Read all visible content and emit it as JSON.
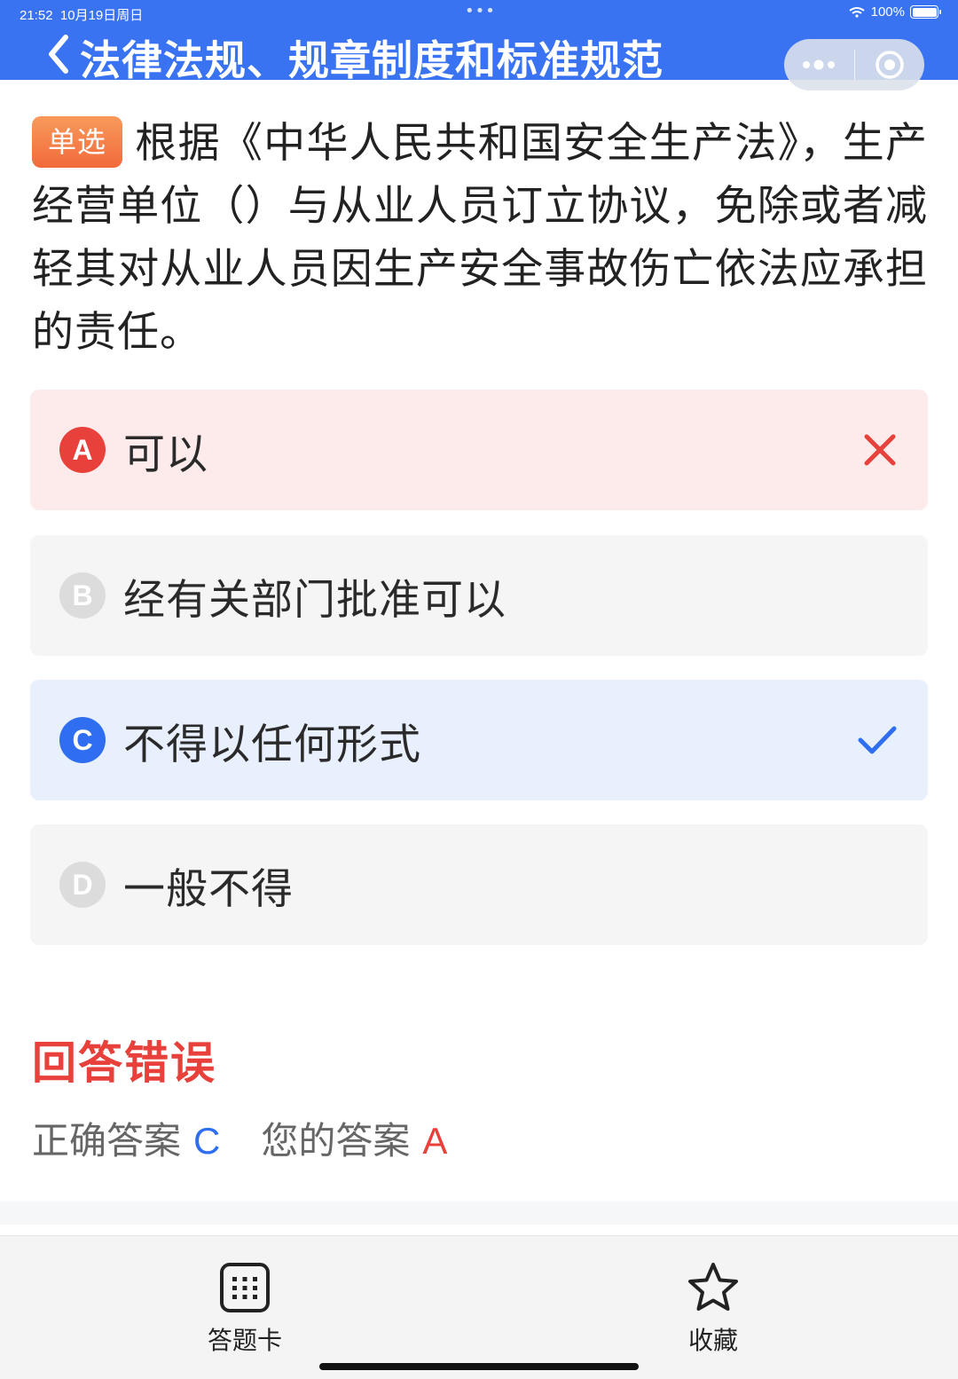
{
  "status_bar": {
    "time": "21:52",
    "date": "10月19日周日",
    "battery": "100%",
    "battery_level": 1.0
  },
  "header": {
    "title": "法律法规、规章制度和标准规范",
    "background_color": "#3a73f2"
  },
  "question": {
    "type_badge": "单选",
    "text": "根据《中华人民共和国安全生产法》，生产经营单位（）与从业人员订立协议，免除或者减轻其对从业人员因生产安全事故伤亡依法应承担的责任。"
  },
  "options": [
    {
      "letter": "A",
      "text": "可以",
      "state": "wrong"
    },
    {
      "letter": "B",
      "text": "经有关部门批准可以",
      "state": "normal"
    },
    {
      "letter": "C",
      "text": "不得以任何形式",
      "state": "correct"
    },
    {
      "letter": "D",
      "text": "一般不得",
      "state": "normal"
    }
  ],
  "result": {
    "title": "回答错误",
    "correct_label": "正确答案",
    "correct_value": "C",
    "your_label": "您的答案",
    "your_value": "A"
  },
  "bottom_bar": {
    "answer_card_label": "答题卡",
    "favorite_label": "收藏"
  },
  "colors": {
    "wrong": "#e8403a",
    "correct": "#2f6ef0",
    "badge": "#f26a3c"
  },
  "icons": [
    "back-icon",
    "more-icon",
    "close-mini-program-icon",
    "wrong-mark-icon",
    "correct-mark-icon",
    "grid-card-icon",
    "star-icon",
    "wifi-icon",
    "battery-icon"
  ]
}
